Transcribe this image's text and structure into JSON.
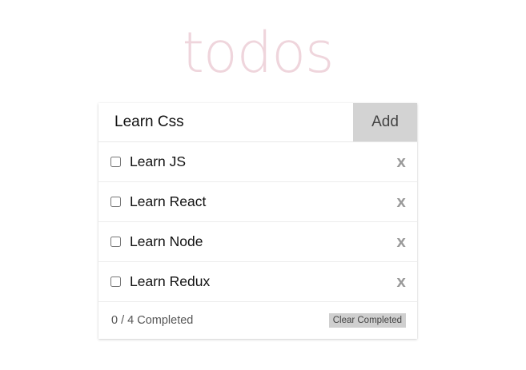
{
  "app": {
    "title": "todos"
  },
  "entry": {
    "value": "Learn Css",
    "add_label": "Add"
  },
  "todos": [
    {
      "label": "Learn JS",
      "completed": false,
      "delete_label": "X"
    },
    {
      "label": "Learn React",
      "completed": false,
      "delete_label": "X"
    },
    {
      "label": "Learn Node",
      "completed": false,
      "delete_label": "X"
    },
    {
      "label": "Learn Redux",
      "completed": false,
      "delete_label": "X"
    }
  ],
  "footer": {
    "count_text": "0 / 4 Completed",
    "clear_label": "Clear Completed"
  },
  "colors": {
    "title": "#efd5dc",
    "add_button_bg": "#d3d3d3",
    "delete_x": "#9a9a9a",
    "clear_button_bg": "#cfcfcf"
  }
}
